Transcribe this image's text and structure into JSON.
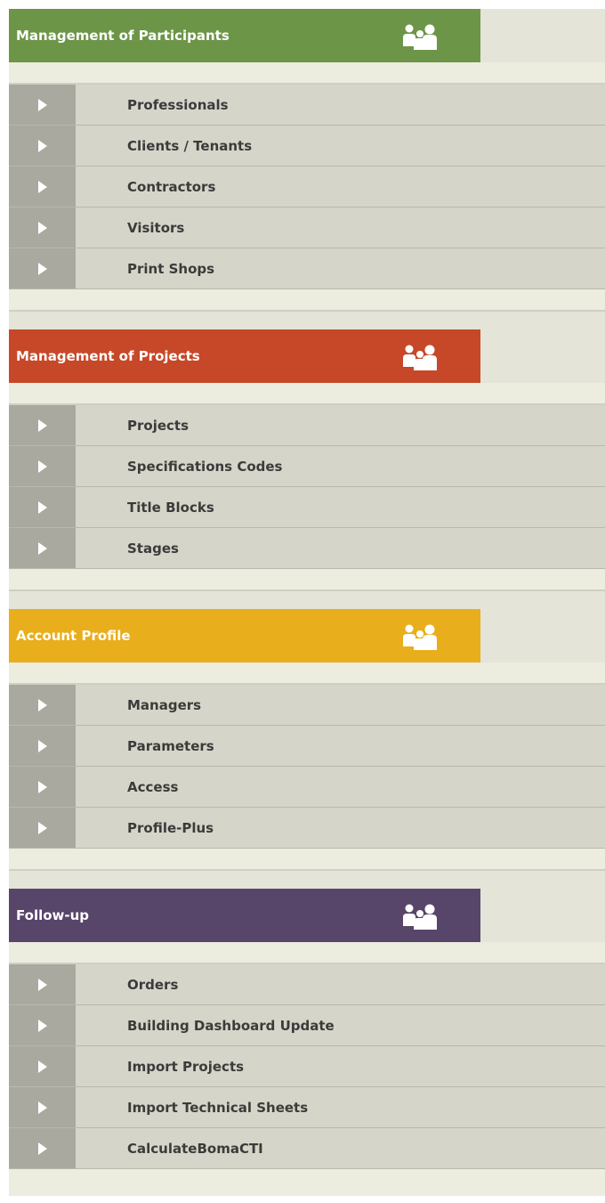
{
  "colors": {
    "participants": "#6d9548",
    "projects": "#c64828",
    "account": "#e8ae1b",
    "followup": "#58456a"
  },
  "sections": [
    {
      "title": "Management of Participants",
      "icon": "people-icon",
      "items": [
        {
          "label": "Professionals"
        },
        {
          "label": "Clients / Tenants"
        },
        {
          "label": "Contractors"
        },
        {
          "label": "Visitors"
        },
        {
          "label": "Print Shops"
        }
      ]
    },
    {
      "title": "Management of Projects",
      "icon": "people-icon",
      "items": [
        {
          "label": "Projects"
        },
        {
          "label": "Specifications Codes"
        },
        {
          "label": "Title Blocks"
        },
        {
          "label": "Stages"
        }
      ]
    },
    {
      "title": "Account Profile",
      "icon": "people-icon",
      "items": [
        {
          "label": "Managers"
        },
        {
          "label": "Parameters"
        },
        {
          "label": "Access"
        },
        {
          "label": "Profile-Plus"
        }
      ]
    },
    {
      "title": "Follow-up",
      "icon": "people-icon",
      "items": [
        {
          "label": "Orders"
        },
        {
          "label": "Building Dashboard Update"
        },
        {
          "label": "Import Projects"
        },
        {
          "label": "Import Technical Sheets"
        },
        {
          "label": "CalculateBomaCTI"
        }
      ]
    }
  ]
}
